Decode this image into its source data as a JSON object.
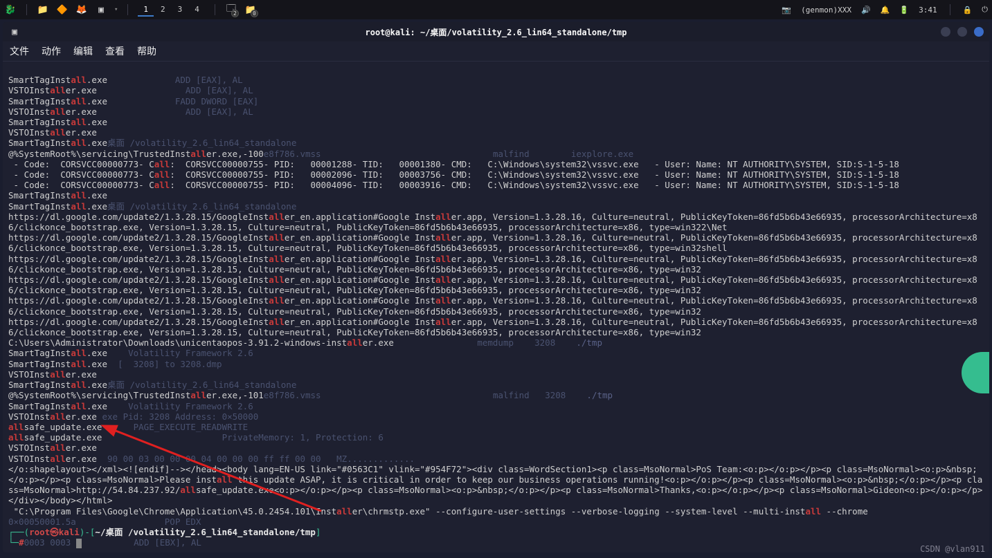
{
  "topbar": {
    "kali_icon": "🐉",
    "files_icon": "📁",
    "burp_icon": "🔶",
    "firefox_icon": "🦊",
    "term_icon": "▣",
    "workspaces": [
      "1",
      "2",
      "3",
      "4"
    ],
    "active_workspace": "1",
    "task1_badge": "2",
    "task2_badge": "0",
    "cam_icon_label": "genmon",
    "genmon": "(genmon)XXX",
    "vol_icon": "🔊",
    "bell_icon": "🔔",
    "battery_icon": "🔋",
    "time": "3:41",
    "lock_icon": "🔒",
    "power_icon": "⏻"
  },
  "win": {
    "menu_icon": "▣",
    "title": "root@kali: ~/桌面/volatility_2.6_lin64_standalone/tmp"
  },
  "menu": {
    "file": "文件",
    "action": "动作",
    "edit": "编辑",
    "view": "查看",
    "help": "帮助"
  },
  "ghost": {
    "path1": "桌面 /volatility_2.6_lin64_standalone",
    "vmss": "e8f786.vmss",
    "malfind": "malfind",
    "iexplore": "iexplore.exe",
    "path2": "桌面 /volatility_2.6_lin64_standalone",
    "tmp": "./tmp",
    "memdump": "memdump",
    "p": "3208",
    "vol": "Volatility Framework 2.6",
    "dmp": "[  3208] to 3208.dmp",
    "pid": "exe Pid: 3208 Address: 0×50000",
    "rw": "PAGE_EXECUTE_READWRITE",
    "pm": "PrivateMemory: 1, Protection: 6",
    "hex": "90 00 03 00 00 00 04 00 00 00 ff ff 00 00   MZ.............",
    "addr": "0×00050001.5a",
    "pop": "POP EDX",
    "addr2": "0003 0003",
    "asm": "ADD [EBX], AL"
  },
  "out": {
    "l1a": "SmartTagInst",
    "l1b": ".exe",
    "asm1": "ADD [EAX], AL",
    "l2a": "VSTOInst",
    "l2b": "er.exe",
    "asm2": "ADD [EAX], AL",
    "asm3": "FADD DWORD [EAX]",
    "asm4": "ADD [EAX], AL",
    "sysroot1": "@%SystemRoot%\\servicing\\TrustedInst",
    "sysroot1b": "er.exe,-100",
    "code1": " - Code:  CORSVCC00000773- C",
    "code1b": ":  CORSVCC00000755- PID:   00001288- TID:   00001380- CMD:   C:\\Windows\\system32\\vssvc.exe   - User: Name: NT AUTHORITY\\SYSTEM, SID:S-1-5-18",
    "code2b": ":  CORSVCC00000755- PID:   00002096- TID:   00003756- CMD:   C:\\Windows\\system32\\vssvc.exe   - User: Name: NT AUTHORITY\\SYSTEM, SID:S-1-5-18",
    "code3b": ":  CORSVCC00000755- PID:   00004096- TID:   00003916- CMD:   C:\\Windows\\system32\\vssvc.exe   - User: Name: NT AUTHORITY\\SYSTEM, SID:S-1-5-18",
    "g1a": "https://dl.google.com/update2/1.3.28.15/GoogleInst",
    "g1b": "er_en.application#Google Inst",
    "g1c": "er.app, Version=1.3.28.16, Culture=neutral, PublicKeyToken=86fd5b6b43e66935, processorArchitecture=x86/clickonce_bootstrap.exe, Version=1.3.28.15, Culture=neutral, PublicKeyToken=86fd5b6b43e66935, processorArchitecture=x86, type=win322\\Net",
    "g2c": "er.app, Version=1.3.28.16, Culture=neutral, PublicKeyToken=86fd5b6b43e66935, processorArchitecture=x86/clickonce_bootstrap.exe, Version=1.3.28.15, Culture=neutral, PublicKeyToken=86fd5b6b43e66935, processorArchitecture=x86, type=win32shell",
    "g3c": "er.app, Version=1.3.28.16, Culture=neutral, PublicKeyToken=86fd5b6b43e66935, processorArchitecture=x86/clickonce_bootstrap.exe, Version=1.3.28.15, Culture=neutral, PublicKeyToken=86fd5b6b43e66935, processorArchitecture=x86, type=win32",
    "g6c": "er.app, Version=1.3.28.16, Culture=neutral, PublicKeyToken=86fd5b6b43e66935, processorArchitecture=x86/clickonce_bootstrap.exe, Version=1.3.28.15, Culture=neutral, PublicKeyToken=86fd5b6b43e66935, processorArchitecture=x86, type=win32",
    "uni_a": "C:\\Users\\Administrator\\Downloads\\unicentaopos-3.91.2-windows-inst",
    "uni_b": "er.exe",
    "sysroot2b": "er.exe,-101",
    "safe": "safe_update.exe",
    "html1": "</o:shapelayout></xml><![endif]--></head><body lang=EN-US link=\"#0563C1\" vlink=\"#954F72\"><div class=WordSection1><p class=MsoNormal>PoS Team:<o:p></o:p></p><p class=MsoNormal><o:p>&nbsp;</o:p></p><p class=MsoNormal>Please inst",
    "html1b": " this update ASAP, it is critical in order to keep our business operations running!<o:p></o:p></p><p class=MsoNormal><o:p>&nbsp;</o:p></p><p class=MsoNormal>http://54.84.237.92/",
    "html1c": "safe_update.exe<o:p></o:p></p><p class=MsoNormal><o:p>&nbsp;</o:p></p><p class=MsoNormal>Thanks,<o:p></o:p></p><p class=MsoNormal>Gideon<o:p></o:p></p></div></body></html>",
    "chrome_a": " \"C:\\Program Files\\Google\\Chrome\\Application\\45.0.2454.101\\Inst",
    "chrome_b": "er\\chrmstp.exe\" --configure-user-settings --verbose-logging --system-level --multi-inst",
    "chrome_c": " --chrome"
  },
  "prompt": {
    "root": "root",
    "at": "㉿",
    "host": "kali",
    "path": "~/桌面 /volatility_2.6_lin64_standalone/tmp",
    "hash": "#"
  },
  "watermark": "CSDN @vlan911",
  "hl_text": "all"
}
